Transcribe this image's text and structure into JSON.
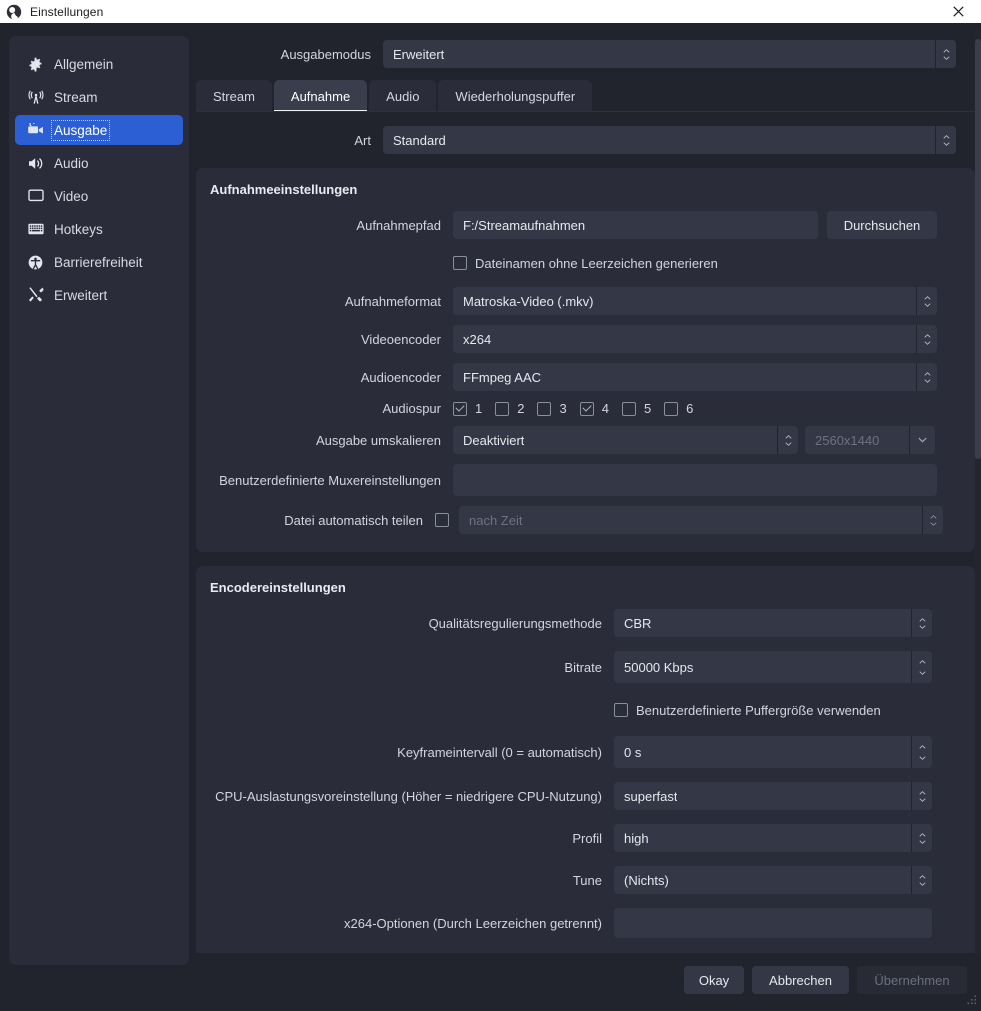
{
  "window": {
    "title": "Einstellungen",
    "logo_icon": "obs-logo-icon",
    "close_icon": "close-icon"
  },
  "sidebar": {
    "items": [
      {
        "label": "Allgemein",
        "icon": "gear-icon",
        "active": false
      },
      {
        "label": "Stream",
        "icon": "broadcast-icon",
        "active": false
      },
      {
        "label": "Ausgabe",
        "icon": "output-camera-icon",
        "active": true
      },
      {
        "label": "Audio",
        "icon": "speaker-icon",
        "active": false
      },
      {
        "label": "Video",
        "icon": "monitor-icon",
        "active": false
      },
      {
        "label": "Hotkeys",
        "icon": "keyboard-icon",
        "active": false
      },
      {
        "label": "Barrierefreiheit",
        "icon": "accessibility-icon",
        "active": false
      },
      {
        "label": "Erweitert",
        "icon": "tools-icon",
        "active": false
      }
    ]
  },
  "output_mode": {
    "label": "Ausgabemodus",
    "value": "Erweitert"
  },
  "tabs": [
    {
      "label": "Stream",
      "active": false
    },
    {
      "label": "Aufnahme",
      "active": true
    },
    {
      "label": "Audio",
      "active": false
    },
    {
      "label": "Wiederholungspuffer",
      "active": false
    }
  ],
  "type_row": {
    "label": "Art",
    "value": "Standard"
  },
  "recording": {
    "panel_title": "Aufnahmeeinstellungen",
    "path": {
      "label": "Aufnahmepfad",
      "value": "F:/Streamaufnahmen",
      "browse_label": "Durchsuchen"
    },
    "no_spaces": {
      "label": "Dateinamen ohne Leerzeichen generieren",
      "checked": false
    },
    "format": {
      "label": "Aufnahmeformat",
      "value": "Matroska-Video (.mkv)"
    },
    "video_encoder": {
      "label": "Videoencoder",
      "value": "x264"
    },
    "audio_encoder": {
      "label": "Audioencoder",
      "value": "FFmpeg AAC"
    },
    "audio_tracks": {
      "label": "Audiospur",
      "tracks": [
        {
          "label": "1",
          "checked": true
        },
        {
          "label": "2",
          "checked": false
        },
        {
          "label": "3",
          "checked": false
        },
        {
          "label": "4",
          "checked": true
        },
        {
          "label": "5",
          "checked": false
        },
        {
          "label": "6",
          "checked": false
        }
      ]
    },
    "rescale": {
      "label": "Ausgabe umskalieren",
      "value": "Deaktiviert",
      "resolution_value": "2560x1440",
      "resolution_disabled": true
    },
    "muxer": {
      "label": "Benutzerdefinierte Muxereinstellungen",
      "value": ""
    },
    "auto_split": {
      "label": "Datei automatisch teilen",
      "checked": false,
      "placeholder": "nach Zeit"
    }
  },
  "encoder": {
    "panel_title": "Encodereinstellungen",
    "rate_control": {
      "label": "Qualitätsregulierungsmethode",
      "value": "CBR"
    },
    "bitrate": {
      "label": "Bitrate",
      "value": "50000 Kbps"
    },
    "custom_buffer": {
      "label": "Benutzerdefinierte Puffergröße verwenden",
      "checked": false
    },
    "keyframe": {
      "label": "Keyframeintervall (0 = automatisch)",
      "value": "0 s"
    },
    "cpu_preset": {
      "label": "CPU-Auslastungsvoreinstellung (Höher = niedrigere CPU-Nutzung)",
      "value": "superfast"
    },
    "profile": {
      "label": "Profil",
      "value": "high"
    },
    "tune": {
      "label": "Tune",
      "value": "(Nichts)"
    },
    "x264_options": {
      "label": "x264-Optionen (Durch Leerzeichen getrennt)",
      "value": ""
    }
  },
  "footer": {
    "ok": "Okay",
    "cancel": "Abbrechen",
    "apply": "Übernehmen",
    "apply_disabled": true
  },
  "colors": {
    "titlebar_bg": "#ffffff",
    "window_bg": "#21232d",
    "panel_bg": "#2a2d39",
    "field_bg": "#343846",
    "accent_selected": "#2d5fd4",
    "text_primary": "#e6e8ef",
    "text_muted": "#6d7181"
  }
}
